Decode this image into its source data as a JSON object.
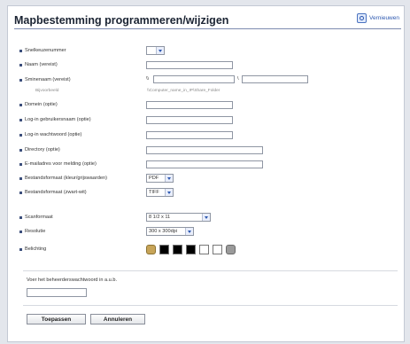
{
  "header": {
    "title": "Mapbestemming programmeren/wijzigen",
    "refresh_label": "Vernieuwen"
  },
  "fields": {
    "quick_dial_label": "Snelkeuzenummer",
    "name_label": "Naam (vereist)",
    "smb_path_label": "Sminenaam (vereist)",
    "smb_prefix_1": "\\\\",
    "smb_prefix_2": "\\",
    "example_label": "Bijvoorbeeld",
    "example_value": "\\\\Computer_name_in_IP\\Share_Folder",
    "domain_label": "Domein (optie)",
    "login_user_label": "Log-in gebruikersnaam (optie)",
    "login_password_label": "Log-in wachtwoord (optie)",
    "directory_label": "Directory (optie)",
    "email_notify_label": "E-mailadres voor melding (optie)",
    "color_format_label": "Bestandsformaat (kleur/grijswaarden)",
    "color_format_value": "PDF",
    "bw_format_label": "Bestandsformaat (zwart-wit)",
    "bw_format_value": "TIFF",
    "scan_size_label": "Scanformaat",
    "scan_size_value": "8 1/2 x 11",
    "resolution_label": "Resolutie",
    "resolution_value": "300 x 300dpi",
    "exposure_label": "Belichting"
  },
  "admin": {
    "password_prompt": "Voer het beheerderswachtwoord in a.u.b."
  },
  "buttons": {
    "apply": "Toepassen",
    "cancel": "Annuleren"
  },
  "exposure_swatches": [
    "lighter-icon",
    "black",
    "black",
    "black",
    "white",
    "white",
    "darker-icon"
  ],
  "colors": {
    "title_rule": "#7d8bb0",
    "bullet": "#3c4f7c",
    "link": "#2d58b0"
  }
}
